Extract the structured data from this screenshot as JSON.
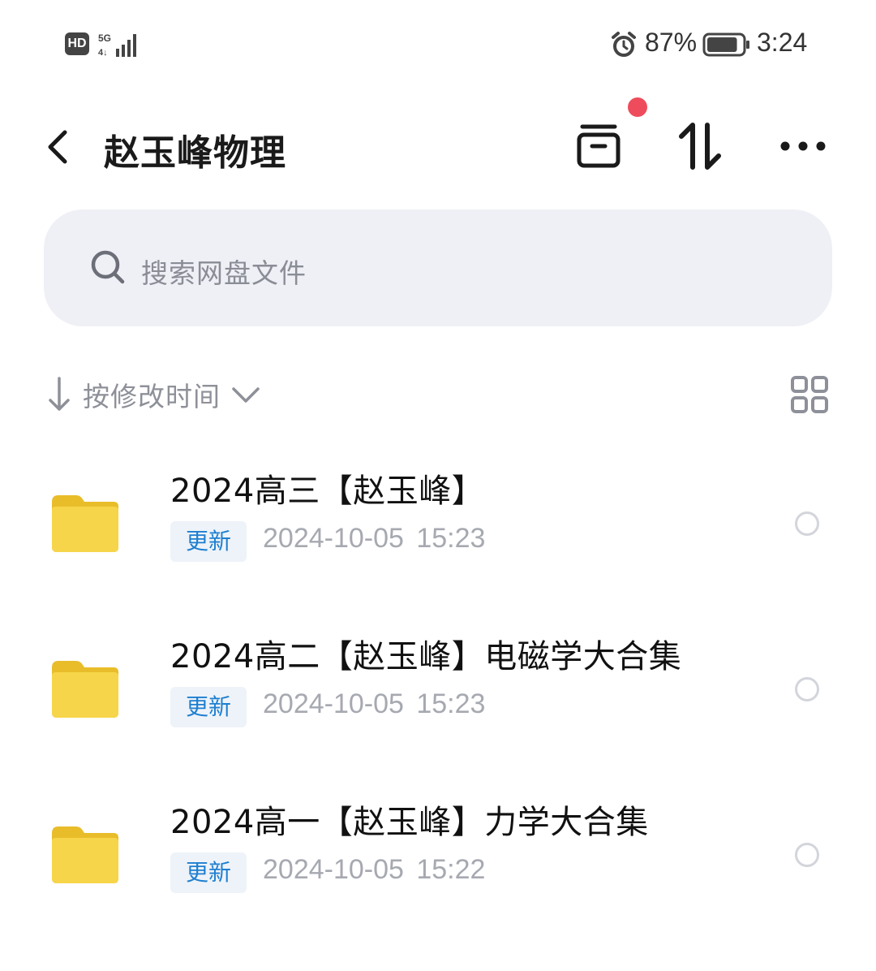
{
  "status_bar": {
    "hd_label": "HD",
    "network_label": "5G",
    "battery_percent": "87%",
    "battery_level": 0.87,
    "time": "3:24",
    "icons": [
      "signal-icon",
      "alarm-icon",
      "battery-icon"
    ]
  },
  "header": {
    "title": "赵玉峰物理",
    "back_icon": "chevron-left-icon",
    "actions": [
      "archive-icon",
      "transfer-icon",
      "more-icon"
    ],
    "notification_dot_color": "#ee4c5c"
  },
  "search": {
    "placeholder": "搜索网盘文件"
  },
  "sort": {
    "label": "按修改时间",
    "direction": "descending"
  },
  "files": [
    {
      "name": "2024高三【赵玉峰】",
      "badge": "更新",
      "modified": "2024-10-05  15:23",
      "type": "folder"
    },
    {
      "name": "2024高二【赵玉峰】电磁学大合集",
      "badge": "更新",
      "modified": "2024-10-05  15:23",
      "type": "folder"
    },
    {
      "name": "2024高一【赵玉峰】力学大合集",
      "badge": "更新",
      "modified": "2024-10-05  15:22",
      "type": "folder"
    }
  ],
  "colors": {
    "folder": "#f7d54a",
    "accent_blue": "#1e7fd0",
    "search_bg": "#eff0f6",
    "muted_text": "#a7a9b1"
  }
}
